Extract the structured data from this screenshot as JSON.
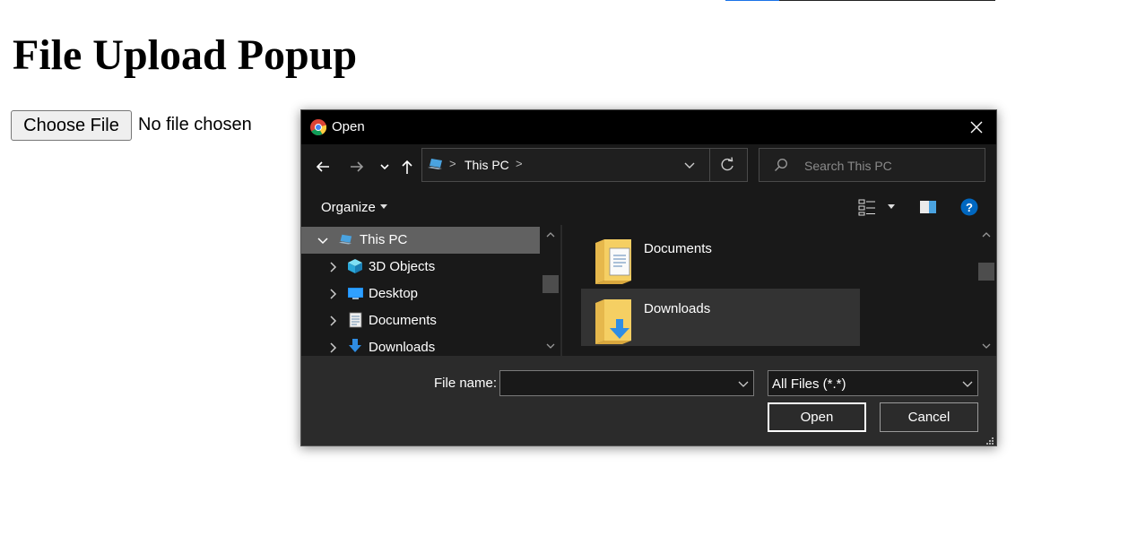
{
  "page": {
    "title": "File Upload Popup",
    "choose_file_label": "Choose File",
    "file_status": "No file chosen"
  },
  "dialog": {
    "title": "Open",
    "address": {
      "crumb": "This PC",
      "sep": ">"
    },
    "search": {
      "placeholder": "Search This PC"
    },
    "toolbar": {
      "organize_label": "Organize"
    },
    "nav_items": [
      {
        "label": "This PC",
        "icon": "pc-icon",
        "expanded": true,
        "selected": true
      },
      {
        "label": "3D Objects",
        "icon": "3d-objects-icon"
      },
      {
        "label": "Desktop",
        "icon": "desktop-icon"
      },
      {
        "label": "Documents",
        "icon": "documents-icon"
      },
      {
        "label": "Downloads",
        "icon": "downloads-icon"
      }
    ],
    "content_items": [
      {
        "name": "Documents",
        "icon": "documents-folder-icon"
      },
      {
        "name": "Downloads",
        "icon": "downloads-folder-icon",
        "hovered": true
      }
    ],
    "file_name": {
      "label": "File name:",
      "value": ""
    },
    "filter": {
      "value": "All Files (*.*)"
    },
    "buttons": {
      "open": "Open",
      "cancel": "Cancel"
    }
  },
  "colors": {
    "titlebar": "#000000",
    "dialog_bg": "#2b2b2b",
    "pane_bg": "#191919",
    "selected_row": "#616161",
    "help_blue": "#0067c0"
  }
}
